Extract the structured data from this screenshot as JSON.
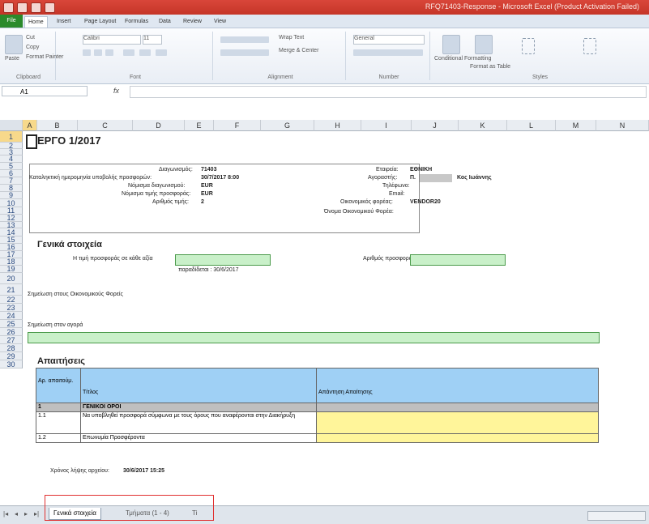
{
  "window": {
    "title": "RFQ71403-Response - Microsoft Excel (Product Activation Failed)"
  },
  "ribbon_tabs": [
    "File",
    "Home",
    "Insert",
    "Page Layout",
    "Formulas",
    "Data",
    "Review",
    "View"
  ],
  "ribbon_groups": [
    "Clipboard",
    "Font",
    "Alignment",
    "Number",
    "Styles"
  ],
  "ribbon_labels": {
    "paste": "Paste",
    "cut": "Cut",
    "copy": "Copy",
    "format_painter": "Format Painter",
    "font": "Calibri",
    "size": "11",
    "wrap": "Wrap Text",
    "merge": "Merge & Center",
    "number": "General",
    "cond_fmt": "Conditional Formatting",
    "format_table": "Format as Table"
  },
  "formula_bar": {
    "name_box": "A1",
    "fx": "fx",
    "value": ""
  },
  "columns": [
    "A",
    "B",
    "C",
    "D",
    "E",
    "F",
    "G",
    "H",
    "I",
    "J",
    "K",
    "L",
    "M",
    "N"
  ],
  "rows": [
    "1",
    "2",
    "3",
    "4",
    "5",
    "6",
    "7",
    "8",
    "9",
    "10",
    "11",
    "12",
    "13",
    "14",
    "15",
    "16",
    "17",
    "18",
    "19",
    "20",
    "21",
    "22",
    "23",
    "24",
    "25",
    "26",
    "27",
    "28",
    "29",
    "30"
  ],
  "sheet": {
    "title": "ΕΡΓΟ 1/2017",
    "info": {
      "doc_num_label": "Διαγωνισμός:",
      "doc_num": "71403",
      "deadline_label": "Καταληκτική ημερομηνία υποβολής προσφορών:",
      "deadline": "30/7/2017 8:00",
      "currency_label": "Νόμισμα διαγωνισμού:",
      "currency": "EUR",
      "offer_currency_label": "Νόμισμα τιμής προσφοράς:",
      "offer_currency": "EUR",
      "decimals_label": "Αριθμός τιμής:",
      "decimals": "2",
      "company_label": "Εταιρεία:",
      "company": "ΕΘΝΙΚΗ",
      "buyer_label": "Αγοραστής:",
      "buyer_prefix": "Π.",
      "buyer": "Κος Ιωάννης",
      "phone_label": "Τηλέφωνο:",
      "email_label": "Email:",
      "vendor_label": "Οικονομικός φορέας:",
      "vendor": "VENDOR20",
      "vendor_name_label": "Όνομα Οικονομικού Φορέα:"
    },
    "general_title": "Γενικά στοιχεία",
    "total_label": "Η τιμή προσφοράς σε κάθε αξία",
    "offer_num_label": "Αριθμός προσφοράς",
    "validity_label": "παραδίδεται : 30/6/2017",
    "notes_vendor_label": "Σημείωση στους Οικονομικούς Φορείς",
    "notes_buyer_label": "Σημείωση στον αγορά",
    "requirements_title": "Απαιτήσεις",
    "table": {
      "headers": [
        "Αρ. απαιτούμ.",
        "Τίτλος",
        "Απάντηση Απαίτησης"
      ],
      "group": {
        "num": "1",
        "title": "ΓΕΝΙΚΟΙ ΟΡΟΙ"
      },
      "rows": [
        {
          "num": "1.1",
          "title": "Να υποβληθεί προσφορά σύμφωνα με τους όρους που αναφέρονται στην Διακήρυξη"
        },
        {
          "num": "1.2",
          "title": "Επωνυμία Προσφέροντα"
        }
      ]
    },
    "timestamp_label": "Χρόνος λήψης αρχείου:",
    "timestamp": "30/6/2017 15:25"
  },
  "sheet_tabs": [
    "Γενικά στοιχεία",
    "Τμήματα (1 - 4)",
    "Ti"
  ]
}
